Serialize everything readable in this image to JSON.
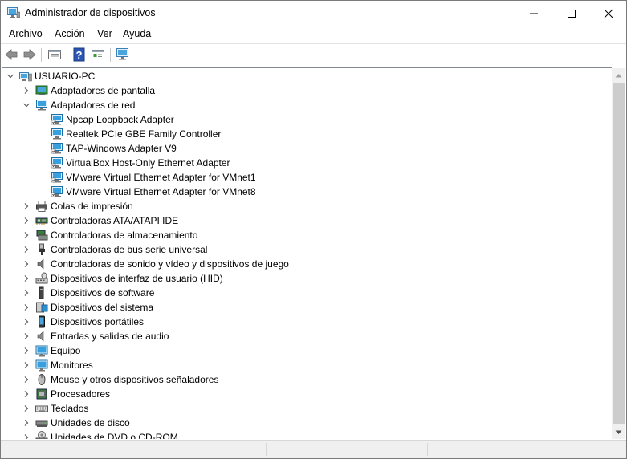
{
  "window": {
    "title": "Administrador de dispositivos",
    "icon": "device-manager-icon"
  },
  "menu": {
    "items": [
      "Archivo",
      "Acción",
      "Ver",
      "Ayuda"
    ]
  },
  "toolbar": {
    "buttons": [
      "back-arrow-icon",
      "forward-arrow-icon",
      "properties-icon",
      "help-icon",
      "view-icon",
      "scan-hardware-icon"
    ]
  },
  "tree": {
    "root": "USUARIO-PC",
    "categories": [
      {
        "label": "Adaptadores de pantalla",
        "expanded": false,
        "icon": "display-adapter-icon"
      },
      {
        "label": "Adaptadores de red",
        "expanded": true,
        "icon": "network-adapter-icon",
        "children": [
          "Npcap Loopback Adapter",
          "Realtek PCIe GBE Family Controller",
          "TAP-Windows Adapter V9",
          "VirtualBox Host-Only Ethernet Adapter",
          "VMware Virtual Ethernet Adapter for VMnet1",
          "VMware Virtual Ethernet Adapter for VMnet8"
        ]
      },
      {
        "label": "Colas de impresión",
        "expanded": false,
        "icon": "printer-icon"
      },
      {
        "label": "Controladoras ATA/ATAPI IDE",
        "expanded": false,
        "icon": "ide-controller-icon"
      },
      {
        "label": "Controladoras de almacenamiento",
        "expanded": false,
        "icon": "storage-controller-icon"
      },
      {
        "label": "Controladoras de bus serie universal",
        "expanded": false,
        "icon": "usb-icon"
      },
      {
        "label": "Controladoras de sonido y vídeo y dispositivos de juego",
        "expanded": false,
        "icon": "speaker-icon"
      },
      {
        "label": "Dispositivos de interfaz de usuario (HID)",
        "expanded": false,
        "icon": "hid-icon"
      },
      {
        "label": "Dispositivos de software",
        "expanded": false,
        "icon": "software-device-icon"
      },
      {
        "label": "Dispositivos del sistema",
        "expanded": false,
        "icon": "system-device-icon"
      },
      {
        "label": "Dispositivos portátiles",
        "expanded": false,
        "icon": "portable-device-icon"
      },
      {
        "label": "Entradas y salidas de audio",
        "expanded": false,
        "icon": "audio-io-icon"
      },
      {
        "label": "Equipo",
        "expanded": false,
        "icon": "computer-icon"
      },
      {
        "label": "Monitores",
        "expanded": false,
        "icon": "monitor-icon"
      },
      {
        "label": "Mouse y otros dispositivos señaladores",
        "expanded": false,
        "icon": "mouse-icon"
      },
      {
        "label": "Procesadores",
        "expanded": false,
        "icon": "processor-icon"
      },
      {
        "label": "Teclados",
        "expanded": false,
        "icon": "keyboard-icon"
      },
      {
        "label": "Unidades de disco",
        "expanded": false,
        "icon": "disk-drive-icon"
      },
      {
        "label": "Unidades de DVD o CD-ROM",
        "expanded": false,
        "icon": "dvd-drive-icon"
      }
    ]
  },
  "colors": {
    "accent": "#1e90c8",
    "chevron": "#5a5a5a"
  }
}
